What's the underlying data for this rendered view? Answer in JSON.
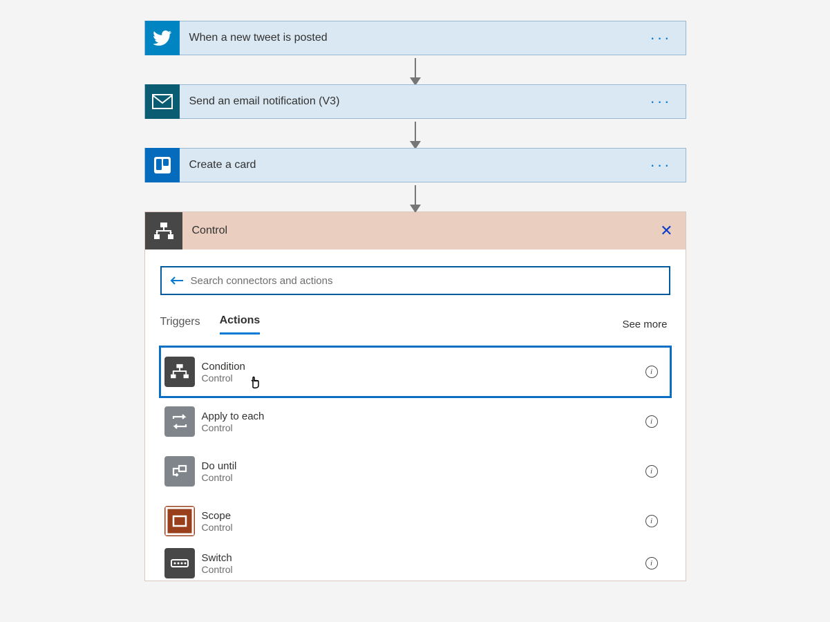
{
  "steps": [
    {
      "title": "When a new tweet is posted"
    },
    {
      "title": "Send an email notification (V3)"
    },
    {
      "title": "Create a card"
    }
  ],
  "panel": {
    "title": "Control",
    "search_placeholder": "Search connectors and actions",
    "tab_triggers": "Triggers",
    "tab_actions": "Actions",
    "see_more": "See more",
    "actions": [
      {
        "title": "Condition",
        "subtitle": "Control"
      },
      {
        "title": "Apply to each",
        "subtitle": "Control"
      },
      {
        "title": "Do until",
        "subtitle": "Control"
      },
      {
        "title": "Scope",
        "subtitle": "Control"
      },
      {
        "title": "Switch",
        "subtitle": "Control"
      }
    ]
  }
}
